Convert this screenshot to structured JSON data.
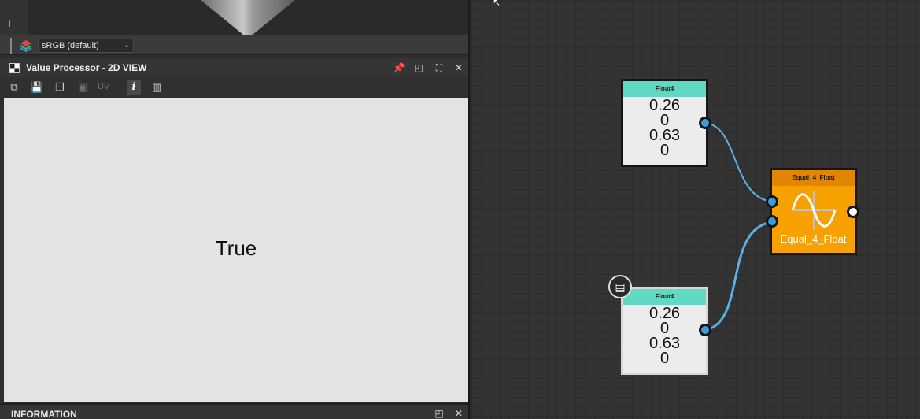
{
  "colorspace": {
    "selected": "sRGB (default)"
  },
  "view_panel": {
    "title": "Value Processor - 2D VIEW",
    "uv_label": "UV",
    "info_label": "i",
    "result": "True"
  },
  "info_panel": {
    "title": "INFORMATION"
  },
  "graph": {
    "node_top": {
      "title": "Float4",
      "values": [
        "0.26",
        "0",
        "0.63",
        "0"
      ]
    },
    "node_bottom": {
      "title": "Float4",
      "values": [
        "0.26",
        "0",
        "0.63",
        "0"
      ]
    },
    "node_eq": {
      "title": "Equal_4_Float",
      "label": "Equal_4_Float"
    }
  },
  "colors": {
    "float_header": "#5fd9c2",
    "eq_body": "#f7a100",
    "eq_header": "#e28500",
    "port": "#3b9ad9",
    "wire": "#5ab0e6"
  }
}
